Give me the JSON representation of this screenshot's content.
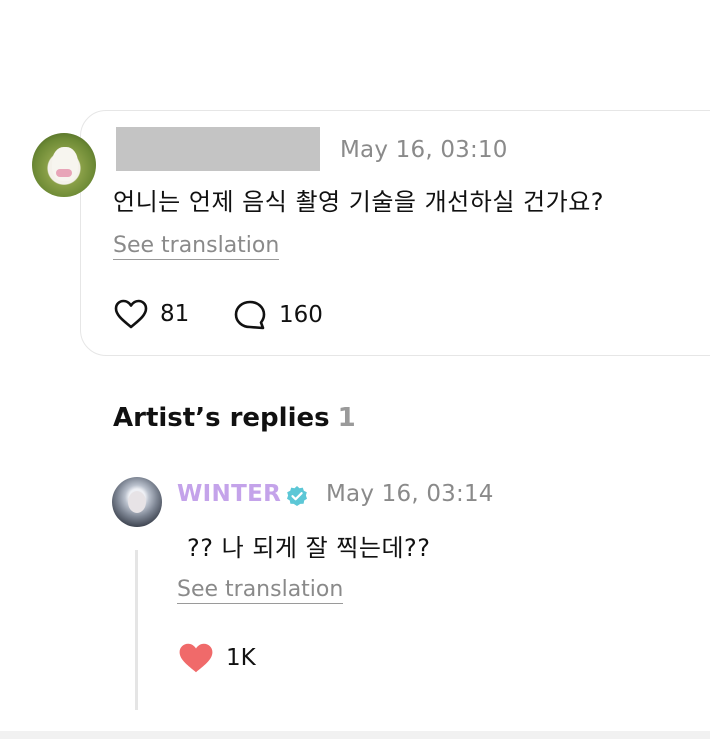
{
  "comment": {
    "timestamp": "May 16, 03:10",
    "text": "언니는 언제 음식 촬영 기술을 개선하실 건가요?",
    "translate_label": "See translation",
    "like_count": "81",
    "reply_count": "160"
  },
  "artist_replies": {
    "title": "Artist’s replies",
    "count": "1"
  },
  "reply": {
    "author": "WINTER",
    "timestamp": "May 16, 03:14",
    "text": "?? 나 되게 잘 찍는데??",
    "translate_label": "See translation",
    "like_count": "1K"
  },
  "colors": {
    "artist_name": "#c4a3ea",
    "verified_badge": "#5cc7d6",
    "liked_heart": "#f06a6a",
    "muted_text": "#8a8a8a"
  },
  "icons": {
    "like": "heart-outline-icon",
    "reply": "speech-bubble-icon",
    "verified": "verified-badge-icon",
    "liked": "heart-filled-icon"
  }
}
